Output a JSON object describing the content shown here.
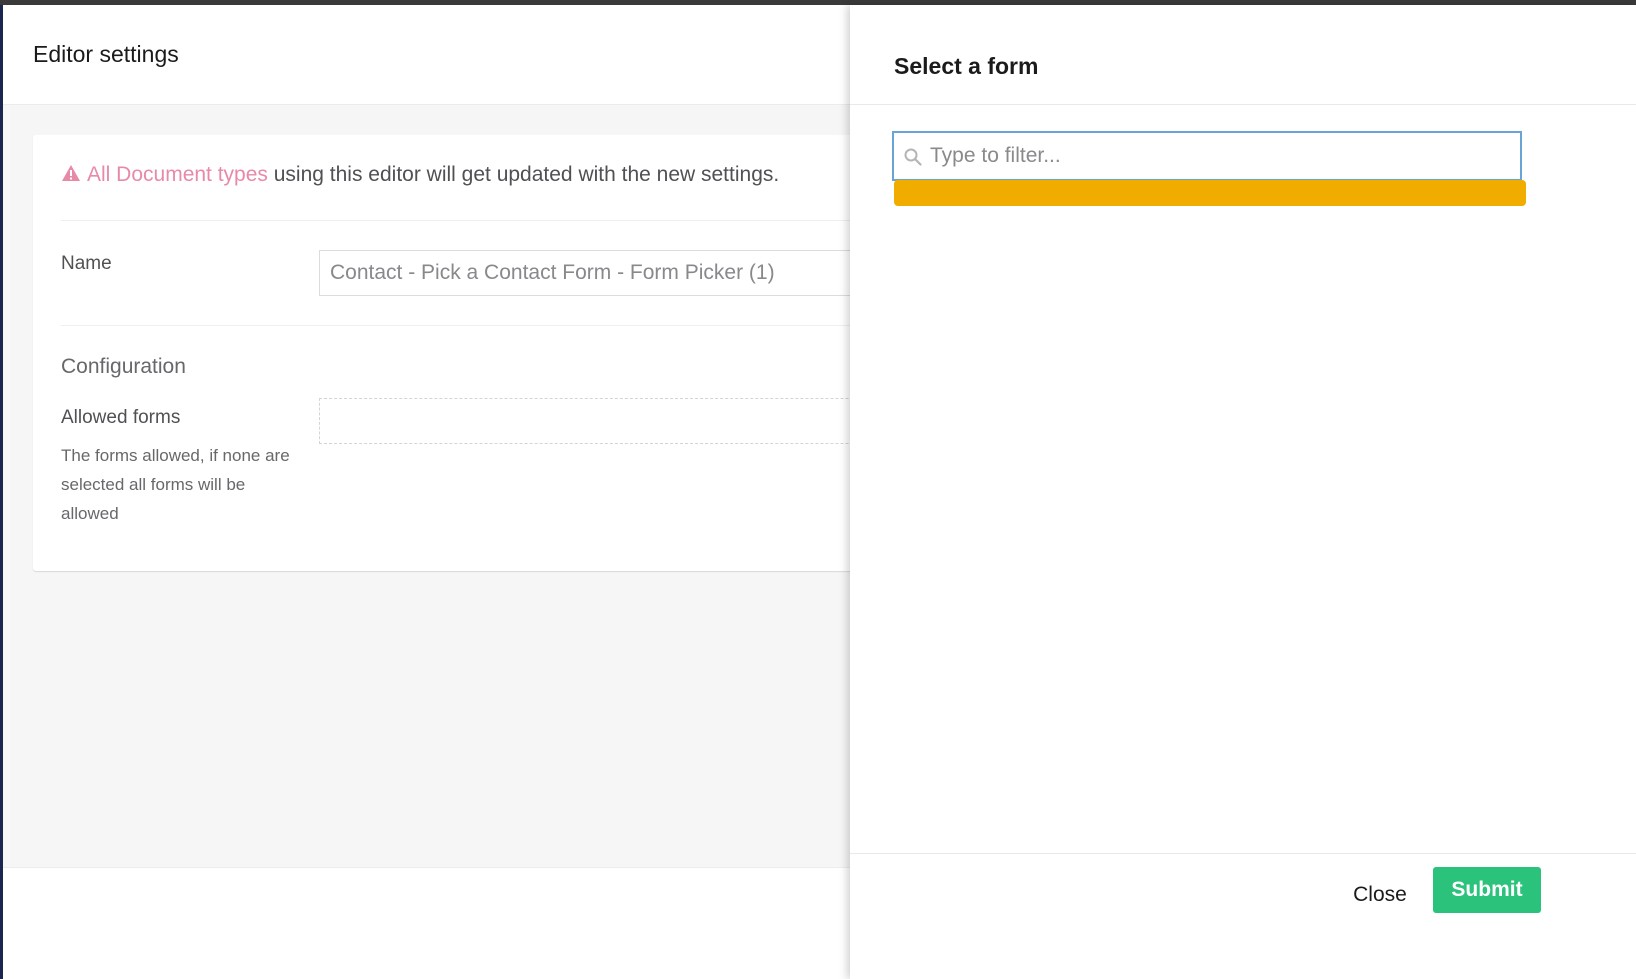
{
  "editor": {
    "title": "Editor settings",
    "notice": {
      "link_text": "All Document types",
      "rest_text": " using this editor will get updated with the new settings."
    },
    "name_label": "Name",
    "name_value": "Contact - Pick a Contact Form - Form Picker (1)",
    "configuration_title": "Configuration",
    "allowed_forms_label": "Allowed forms",
    "allowed_forms_description": "The forms allowed, if none are selected all forms will be allowed"
  },
  "dialog": {
    "title": "Select a form",
    "search_placeholder": "Type to filter...",
    "close_label": "Close",
    "submit_label": "Submit"
  },
  "colors": {
    "link": "#e78aa8",
    "focus_border": "#68a4d6",
    "loading_bar": "#f0ad00",
    "submit": "#2bc37c"
  }
}
